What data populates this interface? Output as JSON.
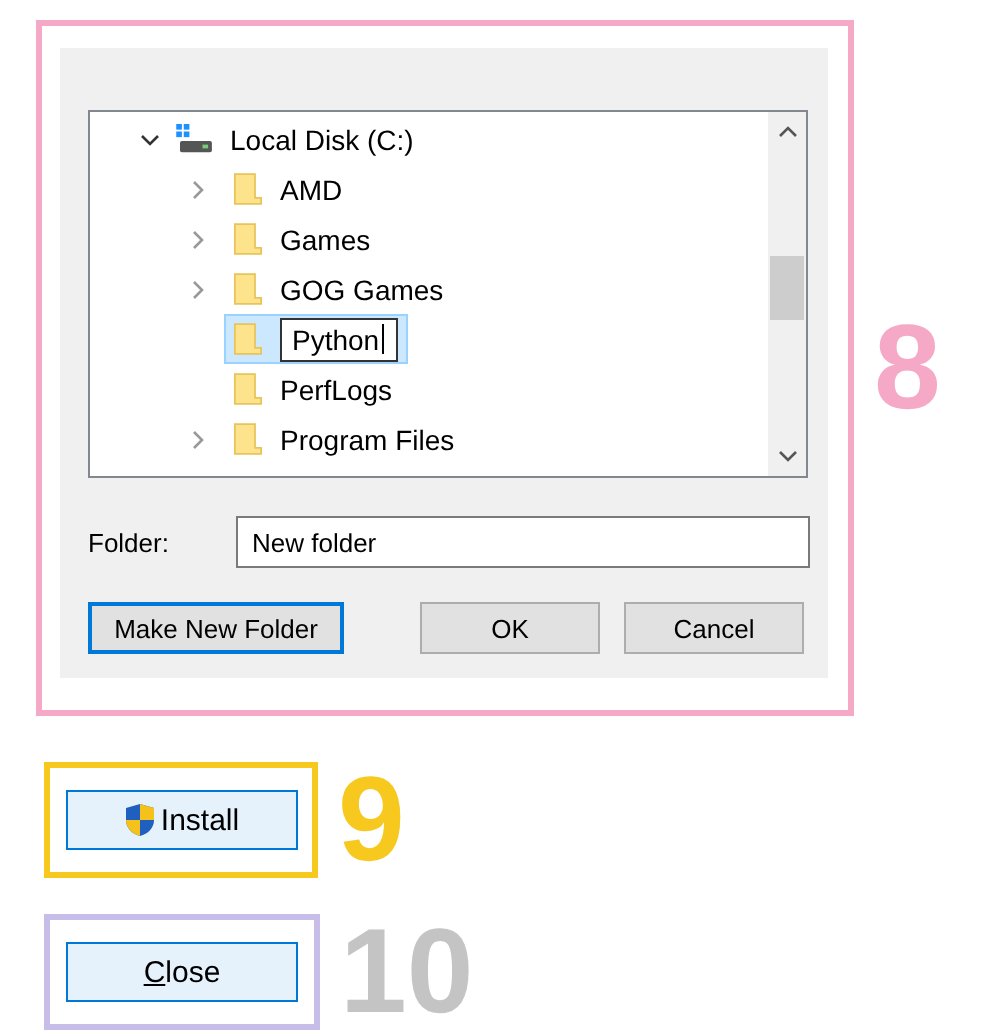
{
  "callouts": [
    {
      "kind": "dialog",
      "number": "8",
      "color": "#f5a9c6",
      "dimmed": false,
      "tree": [
        {
          "label": "Local Disk (C:)",
          "kind": "drive",
          "expanded": true,
          "children": [
            {
              "label": "AMD",
              "has_children": true,
              "selected": false,
              "editing": false
            },
            {
              "label": "Games",
              "has_children": true,
              "selected": false,
              "editing": false
            },
            {
              "label": "GOG Games",
              "has_children": true,
              "selected": false,
              "editing": false
            },
            {
              "label": "Python",
              "has_children": false,
              "selected": true,
              "editing": true
            },
            {
              "label": "PerfLogs",
              "has_children": false,
              "selected": false,
              "editing": false
            },
            {
              "label": "Program Files",
              "has_children": true,
              "selected": false,
              "editing": false
            }
          ]
        }
      ],
      "folder_label": "Folder:",
      "folder_value": "New folder",
      "buttons": [
        {
          "label": "Make New Folder",
          "focused": true
        },
        {
          "label": "OK",
          "focused": false
        },
        {
          "label": "Cancel",
          "focused": false
        }
      ]
    },
    {
      "kind": "button",
      "number": "9",
      "color": "#f7c81e",
      "dimmed": false,
      "label": "Install",
      "shield": true,
      "underline_first": false
    },
    {
      "kind": "button",
      "number": "10",
      "color": "#c8bde8",
      "dimmed": true,
      "label": "Close",
      "shield": false,
      "underline_first": true
    }
  ]
}
